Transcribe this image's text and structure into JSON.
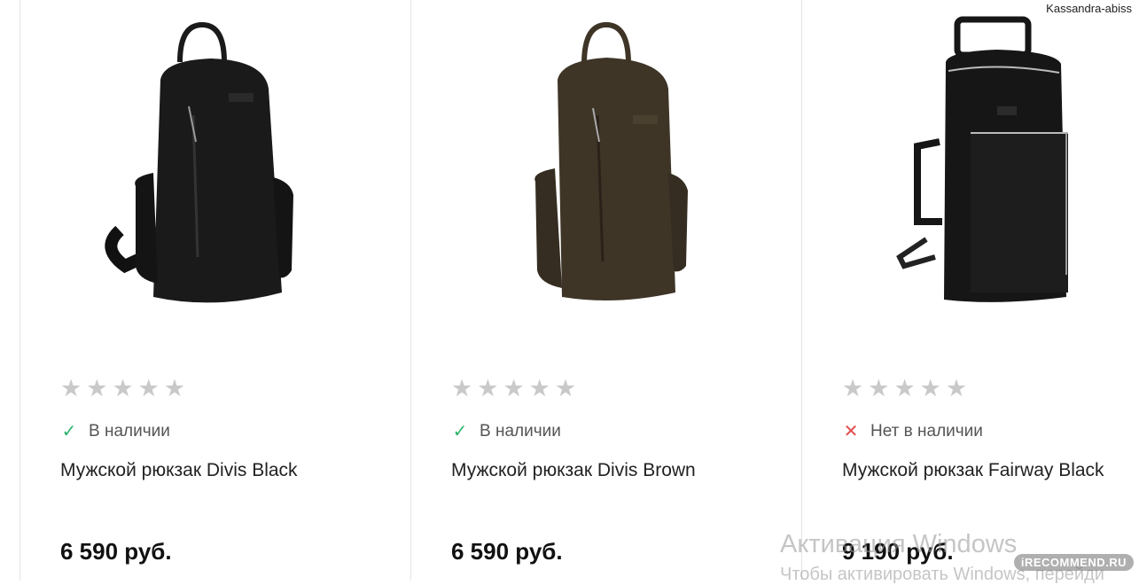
{
  "user": {
    "name": "Kassandra-abiss"
  },
  "products": [
    {
      "title": "Мужской рюкзак Divis Black",
      "price": "6 590 руб.",
      "stock_text": "В наличии",
      "in_stock": true,
      "color": "#1a1a1a",
      "rating": 0
    },
    {
      "title": "Мужской рюкзак Divis Brown",
      "price": "6 590 руб.",
      "stock_text": "В наличии",
      "in_stock": true,
      "color": "#3e3527",
      "rating": 0
    },
    {
      "title": "Мужской рюкзак Fairway Black",
      "price": "9 190 руб.",
      "stock_text": "Нет в наличии",
      "in_stock": false,
      "color": "#161616",
      "rating": 0
    }
  ],
  "windows_watermark": {
    "line1": "Активация Windows",
    "line2": "Чтобы активировать Windows, перейди"
  },
  "site_watermark": "iRECOMMEND.RU",
  "colors": {
    "in_stock": "#2fb56d",
    "out_of_stock": "#e24c4c",
    "star_empty": "#c9c9c9"
  }
}
